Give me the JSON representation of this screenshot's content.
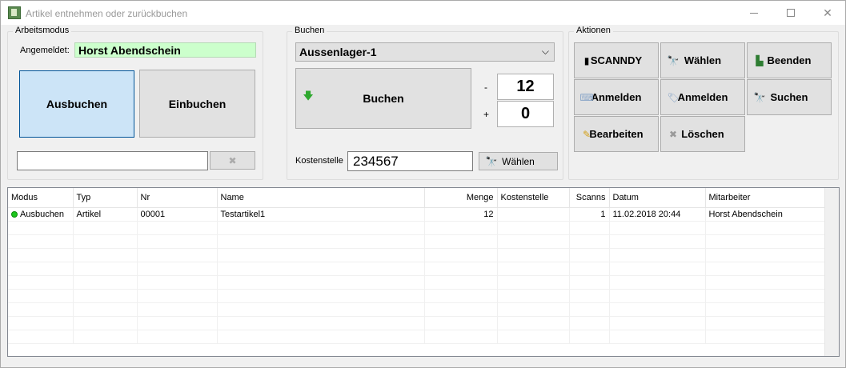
{
  "window": {
    "title": "Artikel entnehmen oder zurückbuchen"
  },
  "arbeitsmodus": {
    "group_label": "Arbeitsmodus",
    "user_label": "Angemeldet:",
    "user_value": "Horst Abendschein",
    "ausbuchen_label": "Ausbuchen",
    "einbuchen_label": "Einbuchen",
    "scan_value": ""
  },
  "buchen": {
    "group_label": "Buchen",
    "lager_selected": "Aussenlager-1",
    "buchen_label": "Buchen",
    "minus_sign": "-",
    "plus_sign": "+",
    "minus_value": "12",
    "plus_value": "0",
    "kostenstelle_label": "Kostenstelle",
    "kostenstelle_value": "234567",
    "waehlen_label": "Wählen"
  },
  "aktionen": {
    "group_label": "Aktionen",
    "buttons": [
      {
        "label": "SCANNDY",
        "icon": "scanner-icon"
      },
      {
        "label": "Wählen",
        "icon": "binoculars-icon"
      },
      {
        "label": "Beenden",
        "icon": "exit-door-icon"
      },
      {
        "label": "Anmelden",
        "icon": "keyboard-icon"
      },
      {
        "label": "Anmelden",
        "icon": "tag-icon"
      },
      {
        "label": "Suchen",
        "icon": "binoculars-icon"
      },
      {
        "label": "Bearbeiten",
        "icon": "edit-icon"
      },
      {
        "label": "Löschen",
        "icon": "delete-x-icon"
      }
    ]
  },
  "table": {
    "headers": [
      "Modus",
      "Typ",
      "Nr",
      "Name",
      "Menge",
      "Kostenstelle",
      "Scanns",
      "Datum",
      "Mitarbeiter"
    ],
    "rows": [
      {
        "modus": "Ausbuchen",
        "typ": "Artikel",
        "nr": "00001",
        "name": "Testartikel1",
        "menge": "12",
        "kostenstelle": "",
        "scanns": "1",
        "datum": "11.02.2018 20:44",
        "mitarbeiter": "Horst Abendschein"
      }
    ]
  },
  "colors": {
    "selected_bg": "#cce4f7",
    "selected_border": "#005499",
    "user_field_bg": "#ccffcc",
    "status_green": "#1cc61c"
  }
}
